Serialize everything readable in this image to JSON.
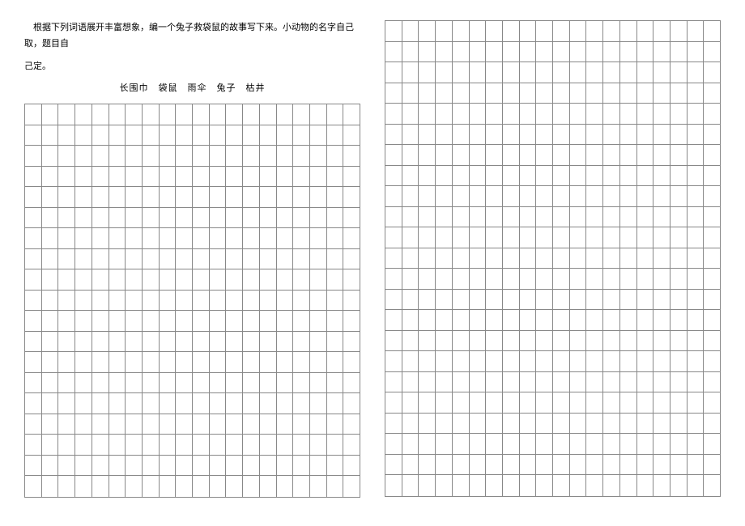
{
  "instruction": {
    "line1": "根据下列词语展开丰富想象，编一个兔子救袋鼠的故事写下来。小动物的名字自己取，题目自",
    "line2": "己定。"
  },
  "words": "长围巾　袋鼠　雨伞　兔子　枯井",
  "grid": {
    "left_rows": 19,
    "right_rows": 23,
    "cols": 20
  }
}
